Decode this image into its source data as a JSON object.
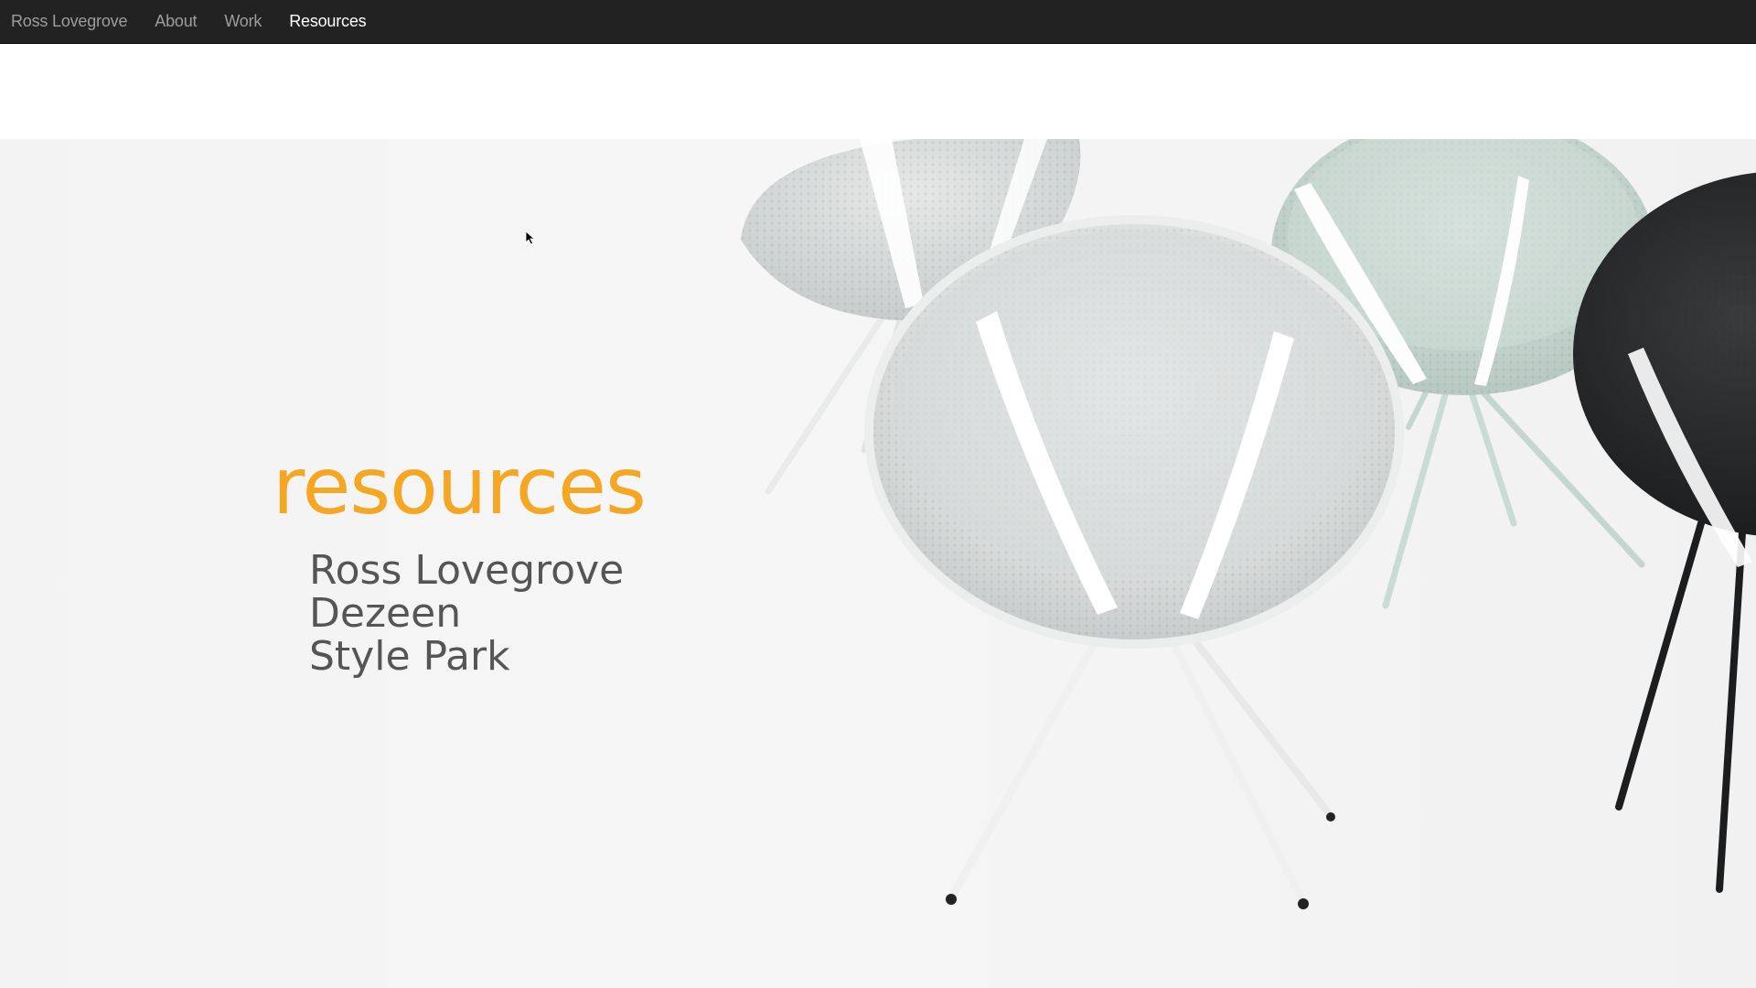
{
  "nav": {
    "brand": "Ross Lovegrove",
    "links": [
      {
        "label": "About"
      },
      {
        "label": "Work"
      },
      {
        "label": "Resources",
        "active": true
      }
    ]
  },
  "hero": {
    "title": "resources",
    "image": "chairs-photo",
    "resources": [
      {
        "label": "Ross Lovegrove"
      },
      {
        "label": "Dezeen"
      },
      {
        "label": "Style Park"
      }
    ]
  },
  "colors": {
    "navbar_bg": "#222222",
    "nav_text": "#9d9d9d",
    "nav_active": "#ffffff",
    "title_accent": "#f5a623",
    "list_text": "#555555"
  }
}
